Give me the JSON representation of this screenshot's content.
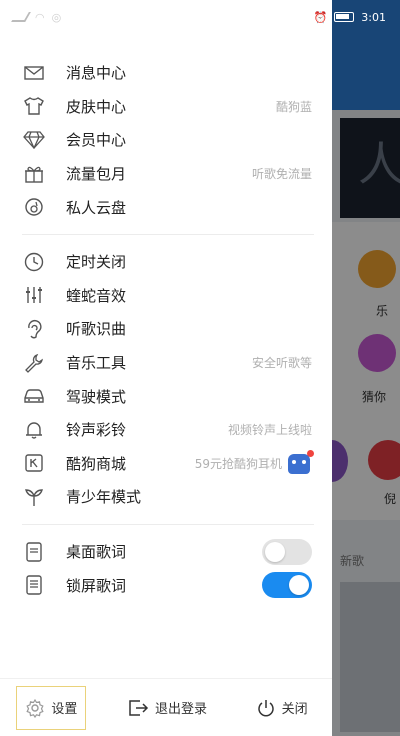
{
  "status": {
    "time": "3:01",
    "battery_icon": "battery-icon"
  },
  "background": {
    "banner_glyph": "人",
    "tile1": "乐",
    "tile2": "猜你",
    "tile3": "倪",
    "section": "新歌"
  },
  "menu_group1": [
    {
      "name": "message",
      "icon": "mail-icon",
      "label": "消息中心",
      "sub": ""
    },
    {
      "name": "skin",
      "icon": "shirt-icon",
      "label": "皮肤中心",
      "sub": "酷狗蓝"
    },
    {
      "name": "vip",
      "icon": "diamond-icon",
      "label": "会员中心",
      "sub": ""
    },
    {
      "name": "data-plan",
      "icon": "gift-icon",
      "label": "流量包月",
      "sub": "听歌免流量"
    },
    {
      "name": "cloud",
      "icon": "cloud-disk-icon",
      "label": "私人云盘",
      "sub": ""
    }
  ],
  "menu_group2": [
    {
      "name": "timer",
      "icon": "clock-icon",
      "label": "定时关闭",
      "sub": ""
    },
    {
      "name": "sound-effect",
      "icon": "equalizer-icon",
      "label": "蝰蛇音效",
      "sub": ""
    },
    {
      "name": "recognize",
      "icon": "ear-icon",
      "label": "听歌识曲",
      "sub": ""
    },
    {
      "name": "tools",
      "icon": "wrench-icon",
      "label": "音乐工具",
      "sub": "安全听歌等"
    },
    {
      "name": "driving",
      "icon": "car-icon",
      "label": "驾驶模式",
      "sub": ""
    },
    {
      "name": "ringtone",
      "icon": "bell-icon",
      "label": "铃声彩铃",
      "sub": "视频铃声上线啦"
    },
    {
      "name": "store",
      "icon": "store-icon",
      "label": "酷狗商城",
      "sub": "59元抢酷狗耳机"
    },
    {
      "name": "youth",
      "icon": "sprout-icon",
      "label": "青少年模式",
      "sub": ""
    }
  ],
  "menu_group3": [
    {
      "name": "desktop-lyrics",
      "icon": "phone-lyrics-icon",
      "label": "桌面歌词",
      "toggle": "off"
    },
    {
      "name": "lockscreen-lyrics",
      "icon": "lock-lyrics-icon",
      "label": "锁屏歌词",
      "toggle": "on"
    }
  ],
  "bottom": {
    "settings_label": "设置",
    "logout_label": "退出登录",
    "close_label": "关闭"
  },
  "colors": {
    "accent": "#1a8bf0",
    "highlight_border": "#ead27a",
    "badge_dot": "#f0443e"
  }
}
